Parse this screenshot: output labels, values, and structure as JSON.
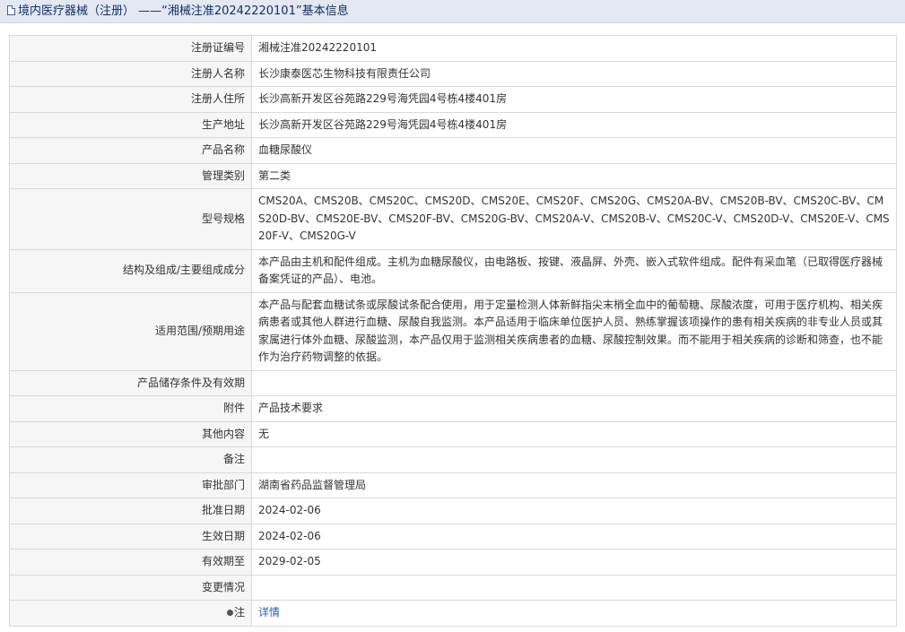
{
  "header": {
    "title": "境内医疗器械（注册） ——“湘械注准20242220101”基本信息"
  },
  "rows": [
    {
      "label": "注册证编号",
      "value": "湘械注准20242220101"
    },
    {
      "label": "注册人名称",
      "value": "长沙康泰医芯生物科技有限责任公司"
    },
    {
      "label": "注册人住所",
      "value": "长沙高新开发区谷苑路229号海凭园4号栋4楼401房"
    },
    {
      "label": "生产地址",
      "value": "长沙高新开发区谷苑路229号海凭园4号栋4楼401房"
    },
    {
      "label": "产品名称",
      "value": "血糖尿酸仪"
    },
    {
      "label": "管理类别",
      "value": "第二类"
    },
    {
      "label": "型号规格",
      "value": "CMS20A、CMS20B、CMS20C、CMS20D、CMS20E、CMS20F、CMS20G、CMS20A-BV、CMS20B-BV、CMS20C-BV、CMS20D-BV、CMS20E-BV、CMS20F-BV、CMS20G-BV、CMS20A-V、CMS20B-V、CMS20C-V、CMS20D-V、CMS20E-V、CMS20F-V、CMS20G-V"
    },
    {
      "label": "结构及组成/主要组成成分",
      "value": "本产品由主机和配件组成。主机为血糖尿酸仪，由电路板、按键、液晶屏、外壳、嵌入式软件组成。配件有采血笔（已取得医疗器械备案凭证的产品）、电池。"
    },
    {
      "label": "适用范围/预期用途",
      "value": "本产品与配套血糖试条或尿酸试条配合使用，用于定量检测人体新鲜指尖末梢全血中的葡萄糖、尿酸浓度，可用于医疗机构、相关疾病患者或其他人群进行血糖、尿酸自我监测。本产品适用于临床单位医护人员、熟练掌握该项操作的患有相关疾病的非专业人员或其家属进行体外血糖、尿酸监测，本产品仅用于监测相关疾病患者的血糖、尿酸控制效果。而不能用于相关疾病的诊断和筛查，也不能作为治疗药物调整的依据。"
    },
    {
      "label": "产品储存条件及有效期",
      "value": ""
    },
    {
      "label": "附件",
      "value": "产品技术要求"
    },
    {
      "label": "其他内容",
      "value": "无"
    },
    {
      "label": "备注",
      "value": ""
    },
    {
      "label": "审批部门",
      "value": "湖南省药品监督管理局"
    },
    {
      "label": "批准日期",
      "value": "2024-02-06"
    },
    {
      "label": "生效日期",
      "value": "2024-02-06"
    },
    {
      "label": "有效期至",
      "value": "2029-02-05"
    },
    {
      "label": "变更情况",
      "value": ""
    }
  ],
  "note": {
    "label": "注",
    "link_text": "详情",
    "icon": "bullet-icon"
  }
}
